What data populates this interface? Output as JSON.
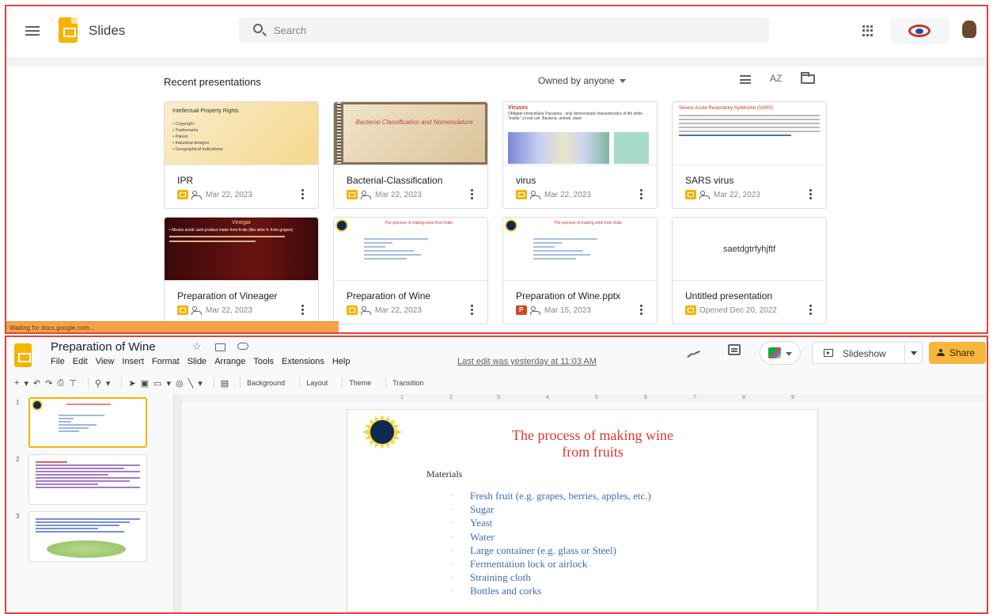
{
  "home": {
    "app_title": "Slides",
    "search_placeholder": "Search",
    "recent_title": "Recent presentations",
    "owner_filter": "Owned by anyone",
    "sort_label": "AZ",
    "status_text": "Waiting for docs.google.com...",
    "presentations": [
      {
        "name": "IPR",
        "date": "Mar 22, 2023",
        "type": "slides",
        "thumb": {
          "title": "Intellectual Property Rights",
          "bullets": [
            "• Copyright",
            "• Trademarks",
            "• Patent",
            "• Industrial designs",
            "• Geographical indications"
          ]
        }
      },
      {
        "name": "Bacterial-Classification",
        "date": "Mar 22, 2023",
        "type": "slides",
        "thumb": {
          "title": "Bacterial Classification and Nomenclature"
        }
      },
      {
        "name": "virus",
        "date": "Mar 22, 2023",
        "type": "slides",
        "thumb": {
          "title": "Viruses",
          "text": "Obligate Intracellular Parasites : only demonstrate characteristics of life while \"inside\" a host cell. Bacteria, animal, plant"
        }
      },
      {
        "name": "SARS virus",
        "date": "Mar 22, 2023",
        "type": "slides",
        "thumb": {
          "title": "Severe Acute Respiratory Syndrome (SARS)"
        }
      },
      {
        "name": "Preparation of Vineager",
        "date": "Mar 22, 2023",
        "type": "slides",
        "thumb": {
          "title": "Vinegar",
          "text": "• Means acetic acid product made from fruits (like wine fr. from grapes)"
        }
      },
      {
        "name": "Preparation of Wine",
        "date": "Mar 22, 2023",
        "type": "slides",
        "thumb": {
          "title": "The process of making wine from fruits"
        }
      },
      {
        "name": "Preparation of Wine.pptx",
        "date": "Mar 15, 2023",
        "type": "pptx",
        "thumb": {
          "title": "The process of making wine from fruits"
        }
      },
      {
        "name": "Untitled presentation",
        "date": "Opened Dec 20, 2022",
        "type": "slides",
        "thumb": {
          "title": "saetdgtrfyhjftf"
        }
      }
    ]
  },
  "editor": {
    "doc_title": "Preparation of Wine",
    "menu": [
      "File",
      "Edit",
      "View",
      "Insert",
      "Format",
      "Slide",
      "Arrange",
      "Tools",
      "Extensions",
      "Help"
    ],
    "last_edit": "Last edit was yesterday at 11:03 AM",
    "slideshow_label": "Slideshow",
    "share_label": "Share",
    "toolbar": {
      "background": "Background",
      "layout": "Layout",
      "theme": "Theme",
      "transition": "Transition"
    },
    "ruler_marks": [
      "1",
      "2",
      "3",
      "4",
      "5",
      "6",
      "7",
      "8",
      "9"
    ],
    "slide_numbers": [
      "1",
      "2",
      "3"
    ],
    "slide": {
      "title_line1": "The process of making wine",
      "title_line2": "from fruits",
      "materials_label": "Materials",
      "materials": [
        "Fresh fruit (e.g. grapes, berries, apples, etc.)",
        "Sugar",
        "Yeast",
        "Water",
        "Large container (e.g. glass or Steel)",
        "Fermentation lock or airlock",
        "Straining cloth",
        "Bottles and corks"
      ]
    }
  },
  "colors": {
    "accent": "#f4b400",
    "frame": "#e8403c",
    "title_red": "#e0352e",
    "list_blue": "#3f6bb5"
  }
}
